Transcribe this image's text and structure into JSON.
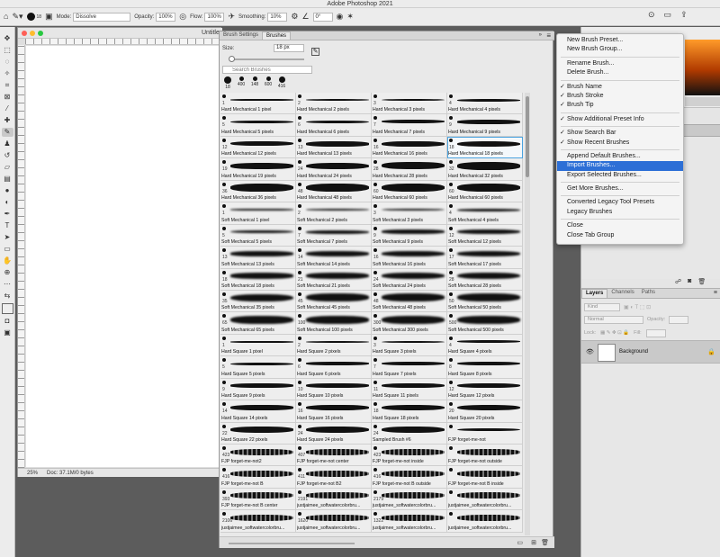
{
  "app": {
    "title": "Adobe Photoshop 2021"
  },
  "options": {
    "brush_size": "18",
    "mode_label": "Mode:",
    "mode_value": "Dissolve",
    "opacity_label": "Opacity:",
    "opacity_value": "100%",
    "flow_label": "Flow:",
    "flow_value": "100%",
    "smoothing_label": "Smoothing:",
    "smoothing_value": "10%",
    "angle_value": "0°"
  },
  "document": {
    "name": "Untitle",
    "zoom": "25%",
    "doc_info": "Doc: 37.1M/0 bytes"
  },
  "brush_panel": {
    "tabs": [
      "Brush Settings",
      "Brushes"
    ],
    "size_label": "Size:",
    "size_value": "18 px",
    "search_placeholder": "Search Brushes",
    "recent": [
      {
        "label": "18"
      },
      {
        "label": "400"
      },
      {
        "label": "148"
      },
      {
        "label": "600"
      },
      {
        "label": "416"
      }
    ],
    "brushes": [
      {
        "n": "1",
        "name": "Hard Mechanical 1 pixel"
      },
      {
        "n": "2",
        "name": "Hard Mechanical 2 pixels"
      },
      {
        "n": "3",
        "name": "Hard Mechanical 3 pixels"
      },
      {
        "n": "4",
        "name": "Hard Mechanical 4 pixels"
      },
      {
        "n": "5",
        "name": "Hard Mechanical 5 pixels"
      },
      {
        "n": "6",
        "name": "Hard Mechanical 6 pixels"
      },
      {
        "n": "7",
        "name": "Hard Mechanical 7 pixels"
      },
      {
        "n": "9",
        "name": "Hard Mechanical 9 pixels"
      },
      {
        "n": "12",
        "name": "Hard Mechanical 12 pixels"
      },
      {
        "n": "13",
        "name": "Hard Mechanical 13 pixels"
      },
      {
        "n": "16",
        "name": "Hard Mechanical 16 pixels"
      },
      {
        "n": "18",
        "name": "Hard Mechanical 18 pixels"
      },
      {
        "n": "19",
        "name": "Hard Mechanical 19 pixels"
      },
      {
        "n": "24",
        "name": "Hard Mechanical 24 pixels"
      },
      {
        "n": "28",
        "name": "Hard Mechanical 28 pixels"
      },
      {
        "n": "32",
        "name": "Hard Mechanical 32 pixels"
      },
      {
        "n": "36",
        "name": "Hard Mechanical 36 pixels"
      },
      {
        "n": "48",
        "name": "Hard Mechanical 48 pixels"
      },
      {
        "n": "60",
        "name": "Hard Mechanical 60 pixels"
      },
      {
        "n": "60",
        "name": "Hard Mechanical 60 pixels"
      },
      {
        "n": "1",
        "name": "Soft Mechanical 1 pixel"
      },
      {
        "n": "2",
        "name": "Soft Mechanical 2 pixels"
      },
      {
        "n": "3",
        "name": "Soft Mechanical 3 pixels"
      },
      {
        "n": "4",
        "name": "Soft Mechanical 4 pixels"
      },
      {
        "n": "5",
        "name": "Soft Mechanical 5 pixels"
      },
      {
        "n": "7",
        "name": "Soft Mechanical 7 pixels"
      },
      {
        "n": "9",
        "name": "Soft Mechanical 9 pixels"
      },
      {
        "n": "12",
        "name": "Soft Mechanical 12 pixels"
      },
      {
        "n": "13",
        "name": "Soft Mechanical 13 pixels"
      },
      {
        "n": "14",
        "name": "Soft Mechanical 14 pixels"
      },
      {
        "n": "16",
        "name": "Soft Mechanical 16 pixels"
      },
      {
        "n": "17",
        "name": "Soft Mechanical 17 pixels"
      },
      {
        "n": "18",
        "name": "Soft Mechanical 18 pixels"
      },
      {
        "n": "21",
        "name": "Soft Mechanical 21 pixels"
      },
      {
        "n": "24",
        "name": "Soft Mechanical 24 pixels"
      },
      {
        "n": "28",
        "name": "Soft Mechanical 28 pixels"
      },
      {
        "n": "35",
        "name": "Soft Mechanical 35 pixels"
      },
      {
        "n": "45",
        "name": "Soft Mechanical 45 pixels"
      },
      {
        "n": "48",
        "name": "Soft Mechanical 48 pixels"
      },
      {
        "n": "50",
        "name": "Soft Mechanical 50 pixels"
      },
      {
        "n": "65",
        "name": "Soft Mechanical 65 pixels"
      },
      {
        "n": "100",
        "name": "Soft Mechanical 100 pixels"
      },
      {
        "n": "300",
        "name": "Soft Mechanical 300 pixels"
      },
      {
        "n": "500",
        "name": "Soft Mechanical 500 pixels"
      },
      {
        "n": "1",
        "name": "Hard Square 1 pixel"
      },
      {
        "n": "2",
        "name": "Hard Square 2 pixels"
      },
      {
        "n": "3",
        "name": "Hard Square 3 pixels"
      },
      {
        "n": "4",
        "name": "Hard Square 4 pixels"
      },
      {
        "n": "5",
        "name": "Hard Square 5 pixels"
      },
      {
        "n": "6",
        "name": "Hard Square 6 pixels"
      },
      {
        "n": "7",
        "name": "Hard Square 7 pixels"
      },
      {
        "n": "8",
        "name": "Hard Square 8 pixels"
      },
      {
        "n": "9",
        "name": "Hard Square 9 pixels"
      },
      {
        "n": "10",
        "name": "Hard Square 10 pixels"
      },
      {
        "n": "11",
        "name": "Hard Square 11 pixels"
      },
      {
        "n": "12",
        "name": "Hard Square 12 pixels"
      },
      {
        "n": "14",
        "name": "Hard Square 14 pixels"
      },
      {
        "n": "16",
        "name": "Hard Square 16 pixels"
      },
      {
        "n": "18",
        "name": "Hard Square 18 pixels"
      },
      {
        "n": "20",
        "name": "Hard Square 20 pixels"
      },
      {
        "n": "22",
        "name": "Hard Square 22 pixels"
      },
      {
        "n": "24",
        "name": "Hard Square 24 pixels"
      },
      {
        "n": "24",
        "name": "Sampled Brush #6"
      },
      {
        "n": "",
        "name": "FJP forget-me-not"
      },
      {
        "n": "423",
        "name": "FJP forget-me-not2"
      },
      {
        "n": "407",
        "name": "FJP forget-me-not center"
      },
      {
        "n": "423",
        "name": "FJP forget-me-not inside"
      },
      {
        "n": "",
        "name": "FJP forget-me-not outside"
      },
      {
        "n": "416",
        "name": "FJP forget-me-not B"
      },
      {
        "n": "411",
        "name": "FJP forget-me-not B2"
      },
      {
        "n": "416",
        "name": "FJP forget-me-not B outside"
      },
      {
        "n": "",
        "name": "FJP forget-me-not B inside"
      },
      {
        "n": "393",
        "name": "FJP forget-me-not B center"
      },
      {
        "n": "2191",
        "name": "justjaimee_softwatercolorbru..."
      },
      {
        "n": "2179",
        "name": "justjaimee_softwatercolorbru..."
      },
      {
        "n": "",
        "name": "justjaimee_softwatercolorbru..."
      },
      {
        "n": "2106",
        "name": "justjaimee_softwatercolorbru..."
      },
      {
        "n": "1620",
        "name": "justjaimee_softwatercolorbru..."
      },
      {
        "n": "1322",
        "name": "justjaimee_softwatercolorbru..."
      },
      {
        "n": "",
        "name": "justjaimee_softwatercolorbru..."
      }
    ]
  },
  "flyout_menu": {
    "items": [
      {
        "label": "New Brush Preset...",
        "checked": false
      },
      {
        "label": "New Brush Group...",
        "checked": false
      },
      {
        "sep": true
      },
      {
        "label": "Rename Brush...",
        "checked": false
      },
      {
        "label": "Delete Brush...",
        "checked": false
      },
      {
        "sep": true
      },
      {
        "label": "Brush Name",
        "checked": true
      },
      {
        "label": "Brush Stroke",
        "checked": true
      },
      {
        "label": "Brush Tip",
        "checked": true
      },
      {
        "sep": true
      },
      {
        "label": "Show Additional Preset Info",
        "checked": true
      },
      {
        "sep": true
      },
      {
        "label": "Show Search Bar",
        "checked": true
      },
      {
        "label": "Show Recent Brushes",
        "checked": true
      },
      {
        "sep": true
      },
      {
        "label": "Append Default Brushes...",
        "checked": false
      },
      {
        "label": "Import Brushes...",
        "checked": false,
        "highlight": true
      },
      {
        "label": "Export Selected Brushes...",
        "checked": false
      },
      {
        "sep": true
      },
      {
        "label": "Get More Brushes...",
        "checked": false
      },
      {
        "sep": true
      },
      {
        "label": "Converted Legacy Tool Presets",
        "checked": false
      },
      {
        "label": "Legacy Brushes",
        "checked": false
      },
      {
        "sep": true
      },
      {
        "label": "Close",
        "checked": false
      },
      {
        "label": "Close Tab Group",
        "checked": false
      }
    ]
  },
  "layers_panel": {
    "tabs": [
      "Layers",
      "Channels",
      "Paths"
    ],
    "kind_label": "Kind",
    "blend_mode": "Normal",
    "opacity_label": "Opacity:",
    "lock_label": "Lock:",
    "fill_label": "Fill:",
    "layer_name": "Background"
  },
  "colors": {
    "accent": "#2d6fd6",
    "selection": "#4aa3df"
  }
}
